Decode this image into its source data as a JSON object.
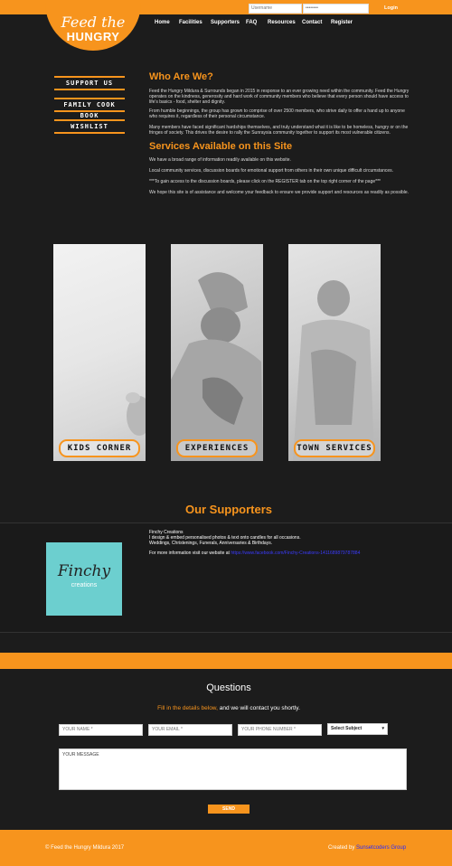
{
  "header": {
    "logo_line1": "Feed the",
    "logo_line2": "HUNGRY",
    "username_placeholder": "Username",
    "password_placeholder": "••••••••",
    "login_label": "Login",
    "nav": [
      "Home",
      "Facilities",
      "Supporters",
      "FAQ",
      "Resources",
      "Contact",
      "Register"
    ]
  },
  "sidebar": {
    "items": [
      "SUPPORT US",
      "FAMILY COOK BOOK",
      "WISHLIST"
    ]
  },
  "about": {
    "title": "Who Are We?",
    "p1": "Feed the Hungry Mildura & Surrounds began in 2015 in response to an ever growing need within the community. Feed the Hungry operates on the kindness, generosity and hard work of community members who believe that every person should have access to life's basics - food, shelter and dignity.",
    "p2": "From humble beginnings, the group has grown to comprise of over 2500 members, who strive daily to offer a hand up to anyone who requires it, regardless of their personal circumstance.",
    "p3": "Many members have faced significant hardships themselves, and truly understand what it is like to be homeless, hungry or on the fringes of society. This drives the desire to rally the Sunraysia community together to support its most vulnerable citizens."
  },
  "services": {
    "title": "Services Available on this Site",
    "p1": "We have a broad range of information readily available on this website.",
    "p2": "Local community services, discussion boards for emotional support from others in their own unique difficult circumstances.",
    "p3": "***To gain access to the discussion boards, please click on the REGISTER tab on the top right corner of the page***",
    "p4": "We hope this site is of assistance and welcome your feedback to ensure we provide support and resources as readily as possible."
  },
  "panels": [
    {
      "label": "KIDS CORNER"
    },
    {
      "label": "EXPERIENCES"
    },
    {
      "label": "TOWN SERVICES"
    }
  ],
  "supporters": {
    "title": "Our Supporters",
    "name": "Finchy Creations",
    "line1": "I design & embed personalised photos & text onto candles for all occasions.",
    "line2": "Weddings, Christenings, Funerals, Anniversaries & Birthdays.",
    "more_prefix": "For more information visit our website at",
    "more_link": "https://www.facebook.com/Finchy-Creations-1411689879787884",
    "logo_name": "Finchy",
    "logo_sub": "creations"
  },
  "questions": {
    "title": "Questions",
    "sub_orange": "Fill in the details below,",
    "sub_white": " and we will contact you shortly.",
    "name_placeholder": "YOUR NAME *",
    "email_placeholder": "YOUR EMAIL *",
    "phone_placeholder": "YOUR PHONE NUMBER *",
    "subject_label": "Select Subject",
    "message_placeholder": "YOUR MESSAGE",
    "send_label": "SEND"
  },
  "footer": {
    "copyright": "© Feed the Hungry Mildura 2017",
    "created_prefix": "Created by",
    "created_link": "Sunsetcoders Group"
  },
  "colors": {
    "accent": "#f7941d",
    "background": "#1c1c1c",
    "supporter_logo": "#6ccfcf"
  }
}
